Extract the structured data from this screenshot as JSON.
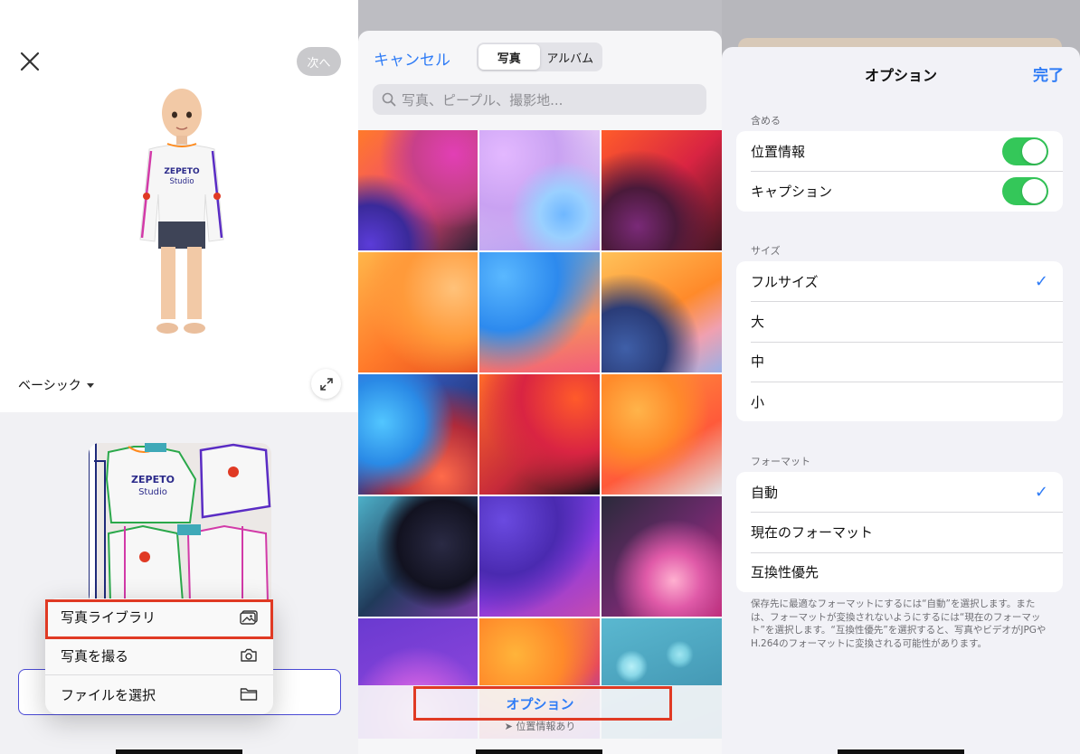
{
  "left_panel": {
    "next_label": "次へ",
    "style_selector_label": "ベーシック",
    "menu": [
      {
        "label": "写真ライブラリ",
        "icon": "photo-library-icon"
      },
      {
        "label": "写真を撮る",
        "icon": "camera-icon"
      },
      {
        "label": "ファイルを選択",
        "icon": "folder-icon"
      }
    ],
    "shirt_brand_line1": "ZEPETO",
    "shirt_brand_line2": "Studio"
  },
  "picker": {
    "cancel_label": "キャンセル",
    "tabs": [
      {
        "label": "写真",
        "selected": true
      },
      {
        "label": "アルバム",
        "selected": false
      }
    ],
    "search_placeholder": "写真、ピープル、撮影地...",
    "options_label": "オプション",
    "location_note": "位置情報あり"
  },
  "options": {
    "title": "オプション",
    "done_label": "完了",
    "include_header": "含める",
    "include_rows": [
      {
        "label": "位置情報",
        "on": true
      },
      {
        "label": "キャプション",
        "on": true
      }
    ],
    "size_header": "サイズ",
    "size_rows": [
      {
        "label": "フルサイズ",
        "checked": true
      },
      {
        "label": "大",
        "checked": false
      },
      {
        "label": "中",
        "checked": false
      },
      {
        "label": "小",
        "checked": false
      }
    ],
    "format_header": "フォーマット",
    "format_rows": [
      {
        "label": "自動",
        "checked": true
      },
      {
        "label": "現在のフォーマット",
        "checked": false
      },
      {
        "label": "互換性優先",
        "checked": false
      }
    ],
    "footnote": "保存先に最適なフォーマットにするには“自動”を選択します。または、フォーマットが変換されないようにするには“現在のフォーマット”を選択します。“互換性優先”を選択すると、写真やビデオがJPGやH.264のフォーマットに変換される可能性があります。",
    "check_glyph": "✓"
  },
  "colors": {
    "accent": "#2f7cf6",
    "highlight": "#e03a24",
    "toggle_on": "#34c759"
  }
}
